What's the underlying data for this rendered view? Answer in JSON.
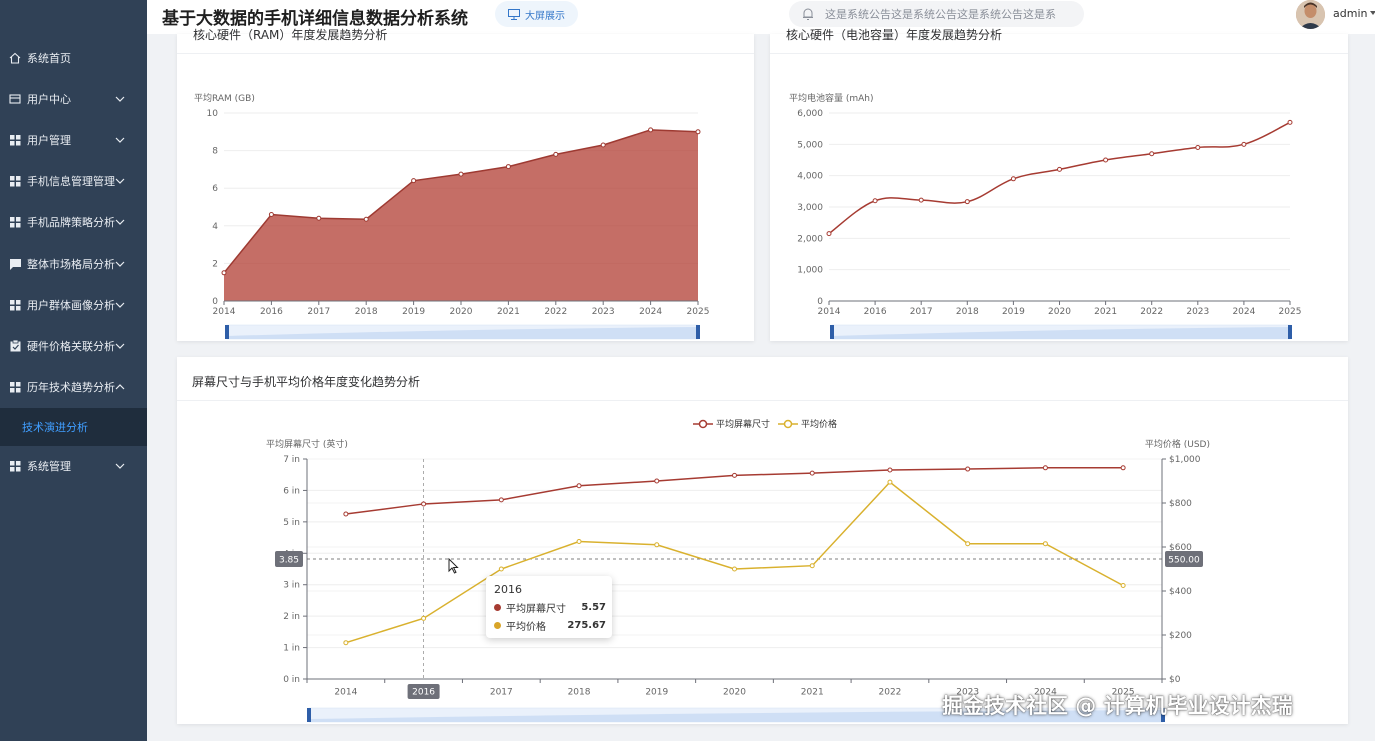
{
  "app": {
    "title": "基于大数据的手机详细信息数据分析系统",
    "bigscreen_label": "大屏展示",
    "notice": "这是系统公告这是系统公告这是系统公告这是系",
    "username": "admin"
  },
  "sidebar": {
    "items": [
      {
        "label": "系统首页",
        "icon": "home-icon"
      },
      {
        "label": "用户中心",
        "icon": "id-card-icon"
      },
      {
        "label": "用户管理",
        "icon": "grid-icon"
      },
      {
        "label": "手机信息管理管理",
        "icon": "grid-icon"
      },
      {
        "label": "手机品牌策略分析",
        "icon": "grid-icon"
      },
      {
        "label": "整体市场格局分析",
        "icon": "chat-icon"
      },
      {
        "label": "用户群体画像分析",
        "icon": "grid-icon"
      },
      {
        "label": "硬件价格关联分析",
        "icon": "clipboard-icon"
      },
      {
        "label": "历年技术趋势分析",
        "icon": "grid-icon"
      },
      {
        "label": "系统管理",
        "icon": "grid-icon"
      }
    ],
    "active_sub": "技术演进分析"
  },
  "cards": {
    "ram_title": "核心硬件（RAM）年度发展趋势分析",
    "battery_title": "核心硬件（电池容量）年度发展趋势分析",
    "screen_title": "屏幕尺寸与手机平均价格年度变化趋势分析"
  },
  "chart_data": [
    {
      "type": "area",
      "title": "",
      "ylabel": "平均RAM (GB)",
      "x": [
        "2014",
        "2016",
        "2017",
        "2018",
        "2019",
        "2020",
        "2021",
        "2022",
        "2023",
        "2024",
        "2025"
      ],
      "values": [
        1.5,
        4.6,
        4.4,
        4.35,
        6.4,
        6.75,
        7.15,
        7.8,
        8.3,
        9.1,
        9.0
      ],
      "ylim": [
        0,
        10
      ],
      "yticks": [
        "0",
        "2",
        "4",
        "6",
        "8",
        "10"
      ],
      "color": "#b5453b"
    },
    {
      "type": "line",
      "title": "",
      "ylabel": "平均电池容量 (mAh)",
      "x": [
        "2014",
        "2016",
        "2017",
        "2018",
        "2019",
        "2020",
        "2021",
        "2022",
        "2023",
        "2024",
        "2025"
      ],
      "values": [
        2150,
        3200,
        3220,
        3170,
        3900,
        4200,
        4500,
        4700,
        4900,
        5000,
        5700
      ],
      "ylim": [
        0,
        6000
      ],
      "yticks": [
        "0",
        "1,000",
        "2,000",
        "3,000",
        "4,000",
        "5,000",
        "6,000"
      ],
      "color": "#a63b32"
    },
    {
      "type": "line",
      "title": "",
      "x": [
        "2014",
        "2016",
        "2017",
        "2018",
        "2019",
        "2020",
        "2021",
        "2022",
        "2023",
        "2024",
        "2025"
      ],
      "legend": [
        "平均屏幕尺寸",
        "平均价格"
      ],
      "series": [
        {
          "name": "平均屏幕尺寸",
          "axis": "left",
          "color": "#a63b32",
          "values": [
            5.25,
            5.57,
            5.7,
            6.15,
            6.3,
            6.48,
            6.55,
            6.65,
            6.68,
            6.72,
            6.72
          ]
        },
        {
          "name": "平均价格",
          "axis": "right",
          "color": "#d9b12e",
          "values": [
            165,
            275.67,
            500,
            625,
            610,
            500,
            515,
            895,
            615,
            615,
            425
          ]
        }
      ],
      "ylabel_left": "平均屏幕尺寸 (英寸)",
      "ylabel_right": "平均价格 (USD)",
      "ylim_left": [
        0,
        7
      ],
      "ylim_right": [
        0,
        1000
      ],
      "yticks_left": [
        "0 in",
        "1 in",
        "2 in",
        "3 in",
        "4 in",
        "5 in",
        "6 in",
        "7 in"
      ],
      "yticks_right": [
        "$0",
        "$200",
        "$400",
        "$600",
        "$800",
        "$1,000"
      ],
      "crosshair_left_label": "3.85",
      "crosshair_right_label": "550.00",
      "highlight_x_label": "2016",
      "tooltip": {
        "year": "2016",
        "screen_name": "平均屏幕尺寸",
        "screen_value": "5.57",
        "price_name": "平均价格",
        "price_value": "275.67"
      }
    }
  ],
  "watermark": "掘金技术社区 @ 计算机毕业设计杰瑞"
}
